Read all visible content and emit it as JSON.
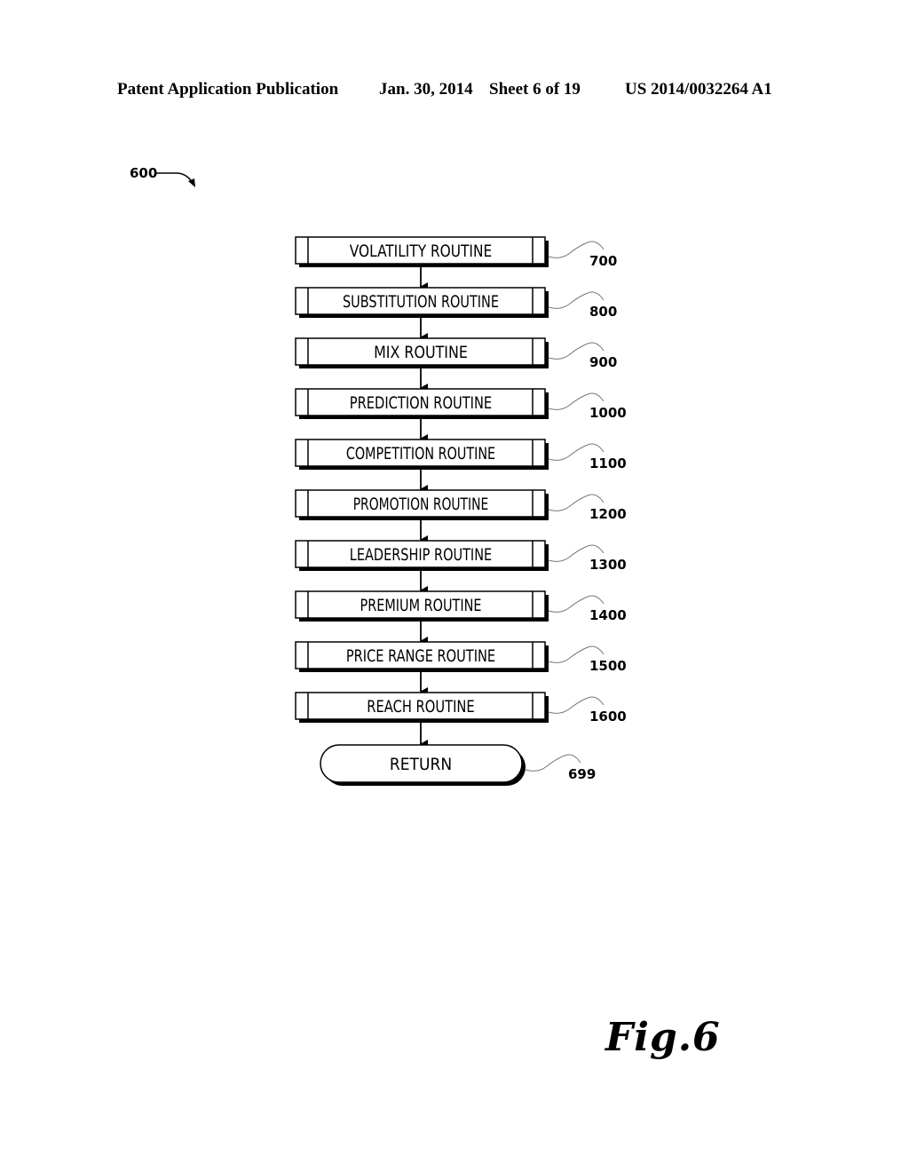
{
  "header": {
    "publication": "Patent Application Publication",
    "date": "Jan. 30, 2014",
    "sheet": "Sheet 6 of 19",
    "number": "US 2014/0032264 A1"
  },
  "figure": {
    "ref": "600",
    "label": "Fig.6"
  },
  "flow": {
    "steps": [
      {
        "label": "VOLATILITY ROUTINE",
        "ref": "700"
      },
      {
        "label": "SUBSTITUTION ROUTINE",
        "ref": "800"
      },
      {
        "label": "MIX ROUTINE",
        "ref": "900"
      },
      {
        "label": "PREDICTION ROUTINE",
        "ref": "1000"
      },
      {
        "label": "COMPETITION ROUTINE",
        "ref": "1100"
      },
      {
        "label": "PROMOTION ROUTINE",
        "ref": "1200"
      },
      {
        "label": "LEADERSHIP ROUTINE",
        "ref": "1300"
      },
      {
        "label": "PREMIUM ROUTINE",
        "ref": "1400"
      },
      {
        "label": "PRICE RANGE ROUTINE",
        "ref": "1500"
      },
      {
        "label": "REACH ROUTINE",
        "ref": "1600"
      }
    ],
    "terminator": {
      "label": "RETURN",
      "ref": "699"
    }
  }
}
